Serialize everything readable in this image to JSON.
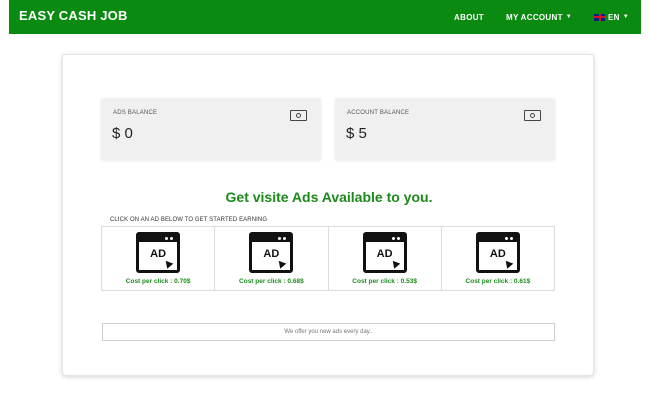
{
  "header": {
    "brand": "EASY CASH JOB",
    "nav": {
      "about": "ABOUT",
      "my_account": "MY ACCOUNT",
      "language": "EN"
    }
  },
  "balances": {
    "ads": {
      "label": "ADS BALANCE",
      "value": "$ 0"
    },
    "account": {
      "label": "ACCOUNT BALANCE",
      "value": "$ 5"
    }
  },
  "headline": "Get visite Ads Available to you.",
  "instruction": "CLICK ON AN AD BELOW TO GET STARTED EARNING",
  "ads": [
    {
      "icon_text": "AD",
      "cost": "Cost per click : 0.70$"
    },
    {
      "icon_text": "AD",
      "cost": "Cost per click : 0.68$"
    },
    {
      "icon_text": "AD",
      "cost": "Cost per click : 0.53$"
    },
    {
      "icon_text": "AD",
      "cost": "Cost per click : 0.61$"
    }
  ],
  "offer_text": "We offer you new ads every day..",
  "colors": {
    "brand_green": "#0b8a11",
    "text_green": "#1b8a1b"
  }
}
